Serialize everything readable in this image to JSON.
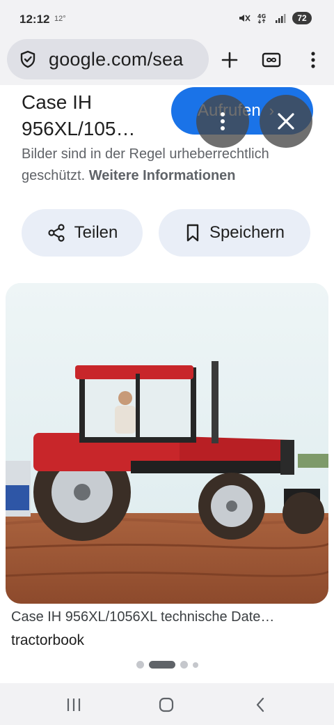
{
  "status_bar": {
    "time": "12:12",
    "temperature": "12°",
    "network": "4G",
    "battery": "72"
  },
  "browser": {
    "url": "google.com/sea",
    "icons": {
      "security": "shield-icon",
      "new_tab": "plus-icon",
      "tab_switcher": "tab-switcher-icon",
      "menu": "more-vert-icon"
    }
  },
  "result": {
    "title": "Case IH 956XL/105…",
    "visit_label": "Aufrufen",
    "copyright_notice": "Bilder sind in der Regel urheberrechtlich geschützt.",
    "more_info_link": "Weitere Informationen",
    "share_label": "Teilen",
    "save_label": "Speichern",
    "image_caption": "Case IH 956XL/1056XL technische Date…",
    "image_source": "tractorbook",
    "image_alt": "red Case IH tractor in a field"
  },
  "carousel": {
    "count": 4,
    "active_index": 1
  },
  "colors": {
    "accent": "#1a73e8",
    "chip_bg": "#e9eef7",
    "tractor_red": "#c8262a"
  }
}
